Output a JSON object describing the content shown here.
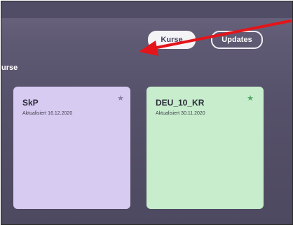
{
  "tabs": {
    "kurse_label": "Kurse",
    "updates_label": "Updates"
  },
  "section": {
    "title": "urse"
  },
  "cards": [
    {
      "title": "SkP",
      "updated": "Aktualisiert 16.12.2020",
      "favorite": true,
      "color": "#d8cbf2"
    },
    {
      "title": "DEU_10_KR",
      "updated": "Aktualisiert 30.11.2020",
      "favorite": true,
      "color": "#c7edcd"
    }
  ],
  "icons": {
    "favorite": "star-icon"
  },
  "colors": {
    "background": "#56516a",
    "annotation_arrow": "#e3151a"
  }
}
